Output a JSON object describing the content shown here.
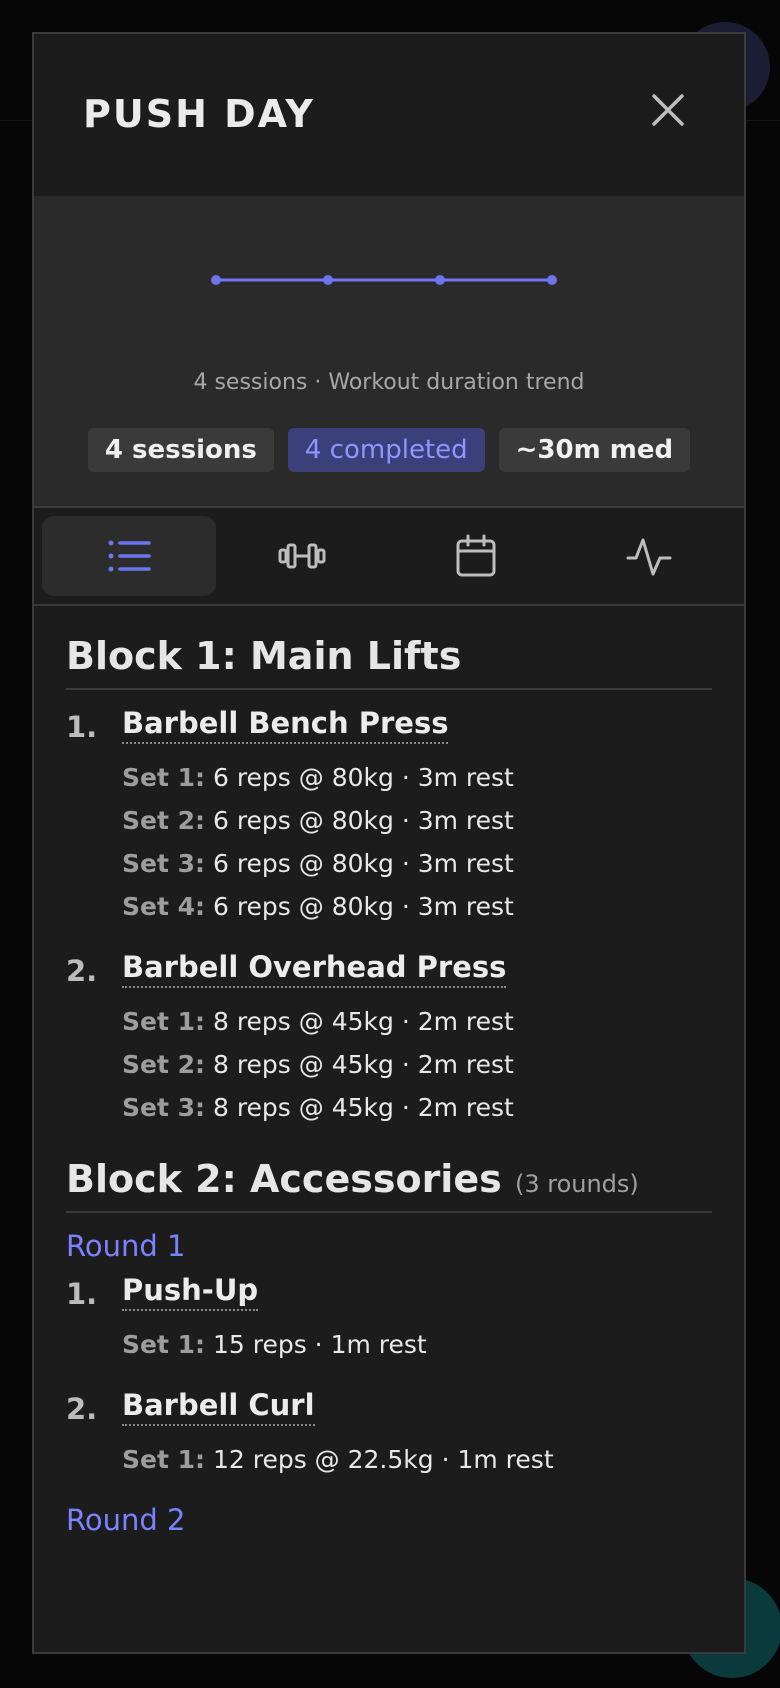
{
  "header": {
    "title": "PUSH DAY"
  },
  "summary": {
    "caption": "4 sessions · Workout duration trend",
    "chips": [
      "4 sessions",
      "4 completed",
      "~30m med"
    ],
    "accent": "#6c74f0"
  },
  "chart_data": {
    "type": "line",
    "x": [
      1,
      2,
      3,
      4
    ],
    "values": [
      30,
      30,
      30,
      30
    ],
    "grid": false,
    "legend": "none"
  },
  "tabs": [
    {
      "icon": "list-icon",
      "active": true
    },
    {
      "icon": "dumbbell-icon",
      "active": false
    },
    {
      "icon": "calendar-icon",
      "active": false
    },
    {
      "icon": "activity-icon",
      "active": false
    }
  ],
  "blocks": [
    {
      "title": "Block 1: Main Lifts",
      "exercises": [
        {
          "num": "1.",
          "name": "Barbell Bench Press",
          "sets": [
            {
              "label": "Set 1:",
              "detail": "6 reps @ 80kg · 3m rest"
            },
            {
              "label": "Set 2:",
              "detail": "6 reps @ 80kg · 3m rest"
            },
            {
              "label": "Set 3:",
              "detail": "6 reps @ 80kg · 3m rest"
            },
            {
              "label": "Set 4:",
              "detail": "6 reps @ 80kg · 3m rest"
            }
          ]
        },
        {
          "num": "2.",
          "name": "Barbell Overhead Press",
          "sets": [
            {
              "label": "Set 1:",
              "detail": "8 reps @ 45kg · 2m rest"
            },
            {
              "label": "Set 2:",
              "detail": "8 reps @ 45kg · 2m rest"
            },
            {
              "label": "Set 3:",
              "detail": "8 reps @ 45kg · 2m rest"
            }
          ]
        }
      ]
    },
    {
      "title": "Block 2: Accessories",
      "subtitle": "(3 rounds)",
      "rounds": [
        {
          "label": "Round 1",
          "exercises": [
            {
              "num": "1.",
              "name": "Push-Up",
              "sets": [
                {
                  "label": "Set 1:",
                  "detail": "15 reps · 1m rest"
                }
              ]
            },
            {
              "num": "2.",
              "name": "Barbell Curl",
              "sets": [
                {
                  "label": "Set 1:",
                  "detail": "12 reps @ 22.5kg · 1m rest"
                }
              ]
            }
          ]
        },
        {
          "label": "Round 2",
          "exercises": []
        }
      ]
    }
  ]
}
